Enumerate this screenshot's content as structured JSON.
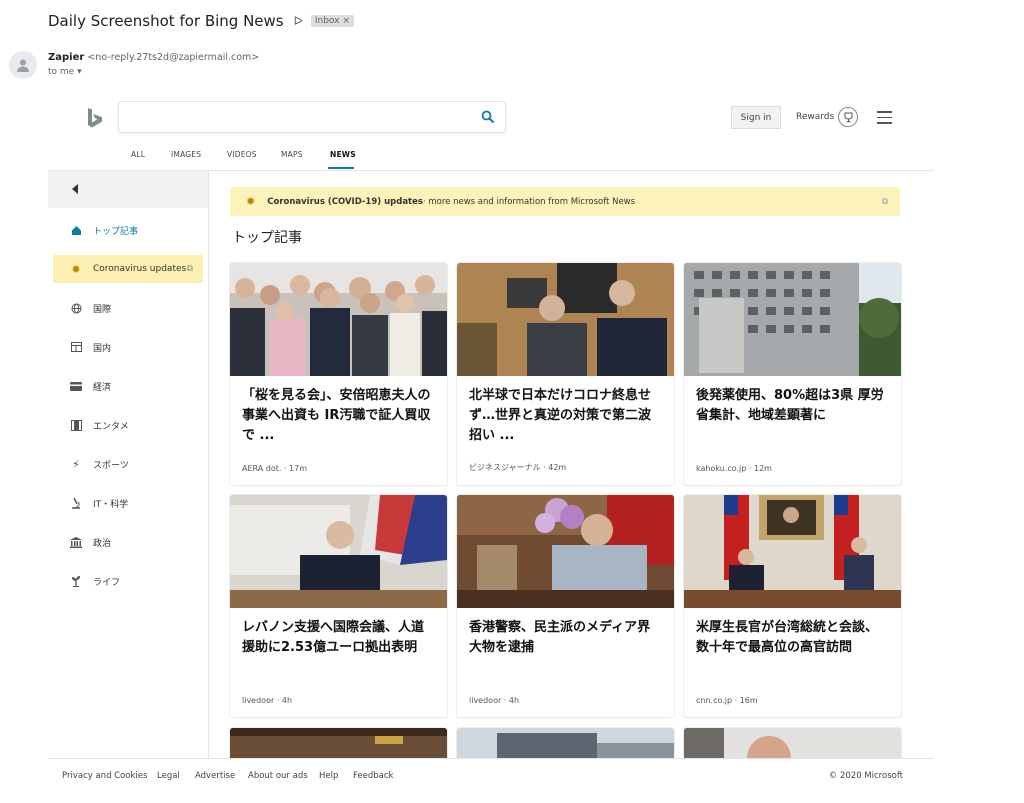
{
  "email": {
    "subject": "Daily Screenshot for Bing News",
    "label": "Inbox",
    "label_close": "×",
    "sender_name": "Zapier",
    "sender_email": "<no-reply.27ts2d@zapiermail.com>",
    "recipient": "to me"
  },
  "bing": {
    "search_placeholder": "",
    "signin_label": "Sign in",
    "rewards_label": "Rewards",
    "nav": [
      "ALL",
      "IMAGES",
      "VIDEOS",
      "MAPS",
      "NEWS"
    ],
    "active_nav": "NEWS"
  },
  "sidebar": {
    "items": [
      {
        "label": "トップ記事",
        "icon": "home-icon"
      },
      {
        "label": "Coronavirus updates",
        "icon": "sun-icon"
      },
      {
        "label": "国際",
        "icon": "globe-icon"
      },
      {
        "label": "国内",
        "icon": "layout-icon"
      },
      {
        "label": "経済",
        "icon": "card-icon"
      },
      {
        "label": "エンタメ",
        "icon": "film-icon"
      },
      {
        "label": "スポーツ",
        "icon": "sports-icon"
      },
      {
        "label": "IT・科学",
        "icon": "microscope-icon"
      },
      {
        "label": "政治",
        "icon": "building-icon"
      },
      {
        "label": "ライフ",
        "icon": "plant-icon"
      }
    ]
  },
  "banner": {
    "bold": "Coronavirus (COVID-19) updates",
    "rest": " · more news and information from Microsoft News"
  },
  "main": {
    "section_title": "トップ記事",
    "cards": [
      {
        "headline": "「桜を見る会」、安倍昭恵夫人の事業へ出資も IR汚職で証人買収で ...",
        "source": "AERA dot. · 17m"
      },
      {
        "headline": "北半球で日本だけコロナ終息せず…世界と真逆の対策で第二波招い ...",
        "source": "ビジネスジャーナル · 42m"
      },
      {
        "headline": "後発薬使用、80%超は3県 厚労省集計、地域差顕著に",
        "source": "kahoku.co.jp · 12m"
      },
      {
        "headline": "レバノン支援へ国際会議、人道援助に2.53億ユーロ拠出表明",
        "source": "livedoor · 4h"
      },
      {
        "headline": "香港警察、民主派のメディア界大物を逮捕",
        "source": "livedoor · 4h"
      },
      {
        "headline": "米厚生長官が台湾総統と会談、数十年で最高位の高官訪問",
        "source": "cnn.co.jp · 16m"
      }
    ]
  },
  "footer": {
    "links": [
      "Privacy and Cookies",
      "Legal",
      "Advertise",
      "About our ads",
      "Help",
      "Feedback"
    ],
    "copyright": "© 2020 Microsoft"
  }
}
